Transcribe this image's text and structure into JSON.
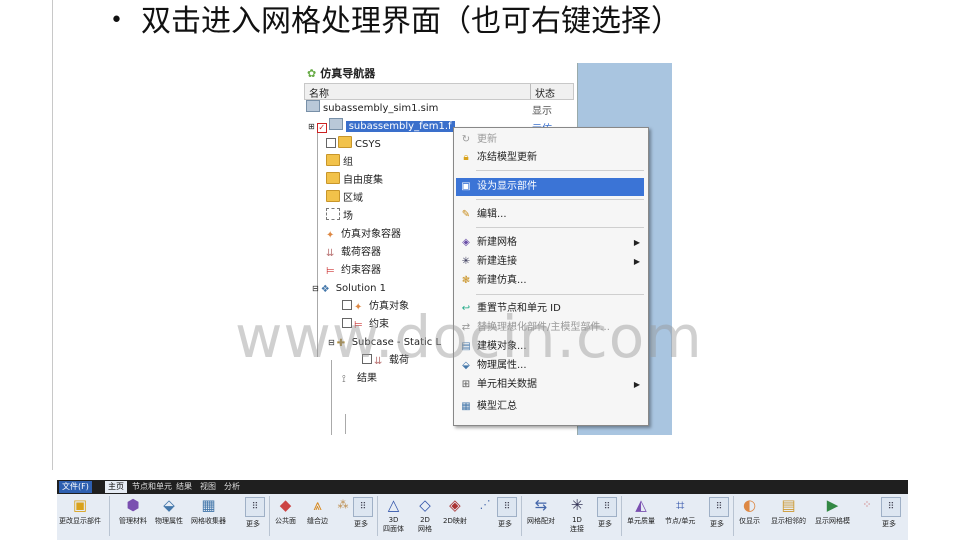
{
  "slide": {
    "bullet": "•",
    "title": "双击进入网格处理界面（也可右键选择）"
  },
  "navigator": {
    "title": "仿真导航器",
    "col_name": "名称",
    "col_status": "状态",
    "status_1": "显示",
    "status_2": "示仿",
    "rows": {
      "sim": "subassembly_sim1.sim",
      "fem": "subassembly_fem1.f",
      "csys": "CSYS",
      "group": "组",
      "dof": "自由度集",
      "region": "区域",
      "field": "场",
      "sim_obj_container": "仿真对象容器",
      "load_container": "载荷容器",
      "constraint_container": "约束容器",
      "solution": "Solution 1",
      "sim_obj": "仿真对象",
      "constraint": "约束",
      "subcase": "Subcase - Static L",
      "load": "载荷",
      "results": "结果"
    }
  },
  "context_menu": {
    "update": "更新",
    "freeze": "冻结模型更新",
    "set_display": "设为显示部件",
    "edit": "编辑...",
    "new_mesh": "新建网格",
    "new_connection": "新建连接",
    "new_sim": "新建仿真...",
    "renumber": "重置节点和单元 ID",
    "replace": "替换理想化部件/主模型部件...",
    "modeling": "建模对象...",
    "physical": "物理属性...",
    "elem_data": "单元相关数据",
    "summary": "模型汇总"
  },
  "watermark": "www.docin.com",
  "ribbon": {
    "tabs": [
      "文件(F)",
      "主页",
      "节点和单元",
      "结果",
      "视图",
      "分析"
    ],
    "buttons": {
      "set_display": "更改显示部件",
      "manage_materials": "管理材料",
      "physical_props": "物理属性",
      "mesh_collector": "网格收集器",
      "more1": "更多",
      "common_face": "公共面",
      "stitch_edge": "缝合边",
      "more2": "更多",
      "mesh_3d_a": "3D",
      "mesh_3d_b": "四面体",
      "mesh_2d_a": "2D",
      "mesh_2d_b": "网格",
      "mesh_2d_map": "2D映射",
      "more3": "更多",
      "mesh_mate": "网格配对",
      "mesh_1d_a": "1D",
      "mesh_1d_b": "连接",
      "more4": "更多",
      "elem_quality": "单元质量",
      "node_elem": "节点/单元",
      "more5": "更多",
      "show_only": "仅显示",
      "show_adjacent": "显示相邻的",
      "show_mesh_model": "显示网格模",
      "more6": "更多"
    }
  }
}
